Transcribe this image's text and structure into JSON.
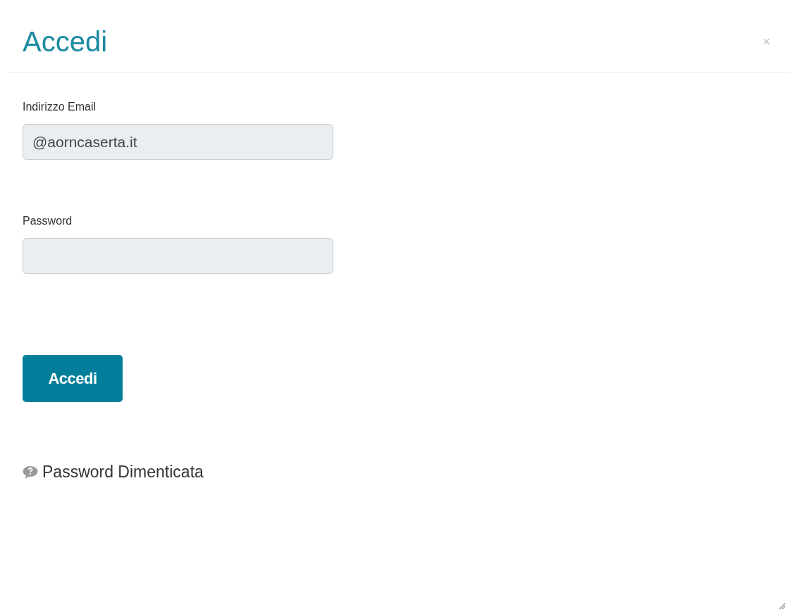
{
  "dialog": {
    "title": "Accedi",
    "close": "×"
  },
  "fields": [
    {
      "kind": "email",
      "label": "Indirizzo Email",
      "value": "@aorncaserta.it"
    },
    {
      "kind": "password",
      "label": "Password"
    }
  ],
  "submit": "Accedi",
  "forgot_link": "Password Dimenticata"
}
